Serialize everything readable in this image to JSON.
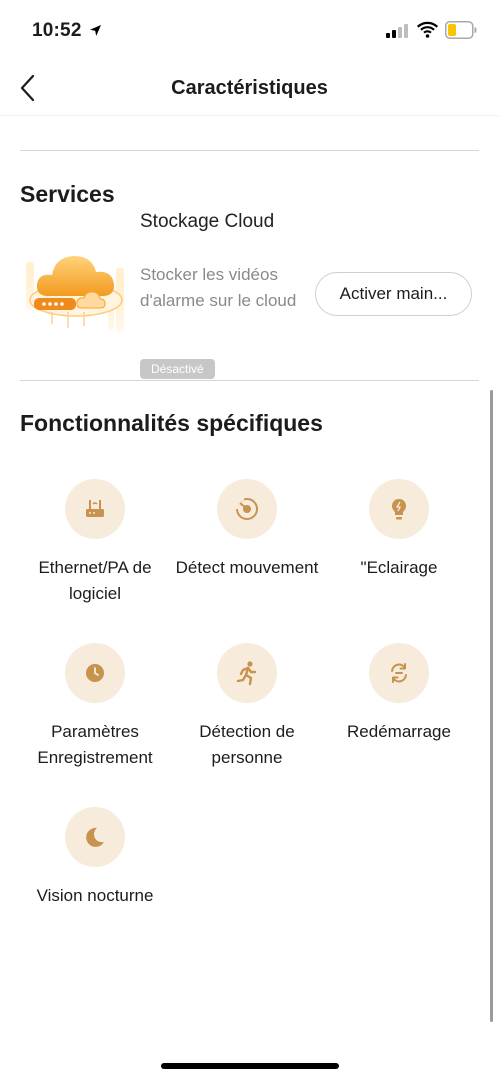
{
  "status_bar": {
    "time": "10:52"
  },
  "nav": {
    "title": "Caractéristiques"
  },
  "services": {
    "title": "Services",
    "cloud": {
      "name": "Stockage Cloud",
      "description": "Stocker les vidéos d'alarme sur le cloud",
      "button_label": "Activer main...",
      "status": "Désactivé"
    }
  },
  "features": {
    "title": "Fonctionnalités spécifiques",
    "items": [
      {
        "label": "Ethernet/PA de logiciel",
        "icon": "router-icon"
      },
      {
        "label": "Détect mouvement",
        "icon": "motion-detect-icon"
      },
      {
        "label": "\"Eclairage",
        "icon": "lightbulb-icon"
      },
      {
        "label": "Paramètres Enregistrement",
        "icon": "clock-icon"
      },
      {
        "label": "Détection de personne",
        "icon": "running-person-icon"
      },
      {
        "label": "Redémarrage",
        "icon": "restart-icon"
      },
      {
        "label": "Vision nocturne",
        "icon": "moon-icon"
      }
    ]
  },
  "colors": {
    "accent": "#c8924f",
    "icon_bg": "#f7ebdc",
    "badge_bg": "#c7c7c7",
    "cloud_orange": "#f5a623"
  }
}
